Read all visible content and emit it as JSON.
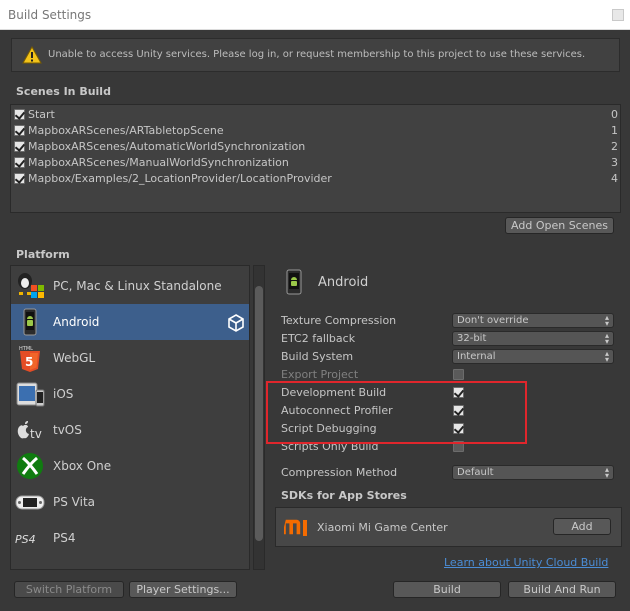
{
  "window": {
    "title": "Build Settings"
  },
  "warning": {
    "message": "Unable to access Unity services. Please log in, or request membership to this project to use these services."
  },
  "scenes": {
    "title": "Scenes In Build",
    "items": [
      {
        "name": "Start",
        "index": "0"
      },
      {
        "name": "MapboxARScenes/ARTabletopScene",
        "index": "1"
      },
      {
        "name": "MapboxARScenes/AutomaticWorldSynchronization",
        "index": "2"
      },
      {
        "name": "MapboxARScenes/ManualWorldSynchronization",
        "index": "3"
      },
      {
        "name": "Mapbox/Examples/2_LocationProvider/LocationProvider",
        "index": "4"
      }
    ],
    "add_open_scenes_label": "Add Open Scenes"
  },
  "platform": {
    "title": "Platform",
    "items": [
      {
        "label": "PC, Mac & Linux Standalone",
        "icon": "pc-mac-linux-icon"
      },
      {
        "label": "Android",
        "icon": "android-icon"
      },
      {
        "label": "WebGL",
        "icon": "html5-icon"
      },
      {
        "label": "iOS",
        "icon": "ios-device-icon"
      },
      {
        "label": "tvOS",
        "icon": "apple-tv-icon"
      },
      {
        "label": "Xbox One",
        "icon": "xbox-icon"
      },
      {
        "label": "PS Vita",
        "icon": "ps-vita-icon"
      },
      {
        "label": "PS4",
        "icon": "ps4-icon"
      }
    ],
    "selected": "Android"
  },
  "settings": {
    "header": "Android",
    "texture_compression": {
      "label": "Texture Compression",
      "value": "Don't override"
    },
    "etc2_fallback": {
      "label": "ETC2 fallback",
      "value": "32-bit"
    },
    "build_system": {
      "label": "Build System",
      "value": "Internal"
    },
    "export_project": {
      "label": "Export Project"
    },
    "development_build": {
      "label": "Development Build"
    },
    "autoconnect_profiler": {
      "label": "Autoconnect Profiler"
    },
    "script_debugging": {
      "label": "Script Debugging"
    },
    "scripts_only_build": {
      "label": "Scripts Only Build"
    },
    "compression_method": {
      "label": "Compression Method",
      "value": "Default"
    }
  },
  "sdks": {
    "title": "SDKs for App Stores",
    "item_name": "Xiaomi Mi Game Center",
    "add_label": "Add"
  },
  "footer": {
    "cloud_build_link": "Learn about Unity Cloud Build",
    "switch_platform_label": "Switch Platform",
    "player_settings_label": "Player Settings...",
    "build_label": "Build",
    "build_and_run_label": "Build And Run"
  },
  "colors": {
    "accent_selected": "#3d5f8c",
    "highlight": "#e0262c",
    "link": "#4b8dd6"
  }
}
